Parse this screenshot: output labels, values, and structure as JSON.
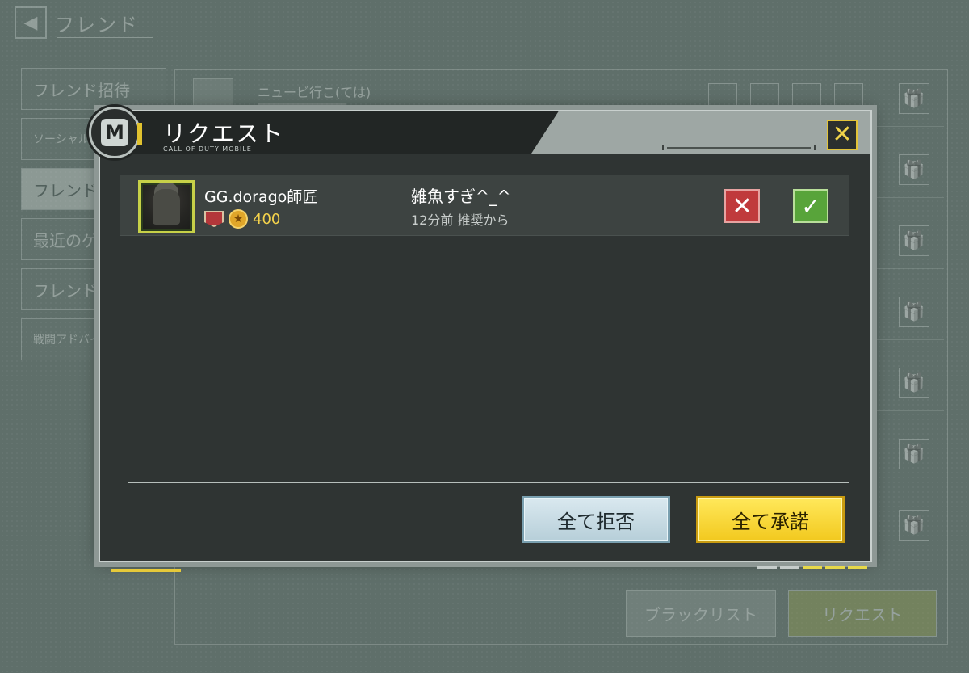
{
  "background": {
    "title": "フレンド",
    "sidebar": [
      {
        "label": "フレンド招待"
      },
      {
        "label": "ソーシャル"
      },
      {
        "label": "フレンド"
      },
      {
        "label": "最近のゲ"
      },
      {
        "label": "フレンド追加"
      },
      {
        "label": "戦闘アドバイ"
      }
    ],
    "list_rows": [
      {
        "name": "ニュービ行こ(ては)"
      },
      {
        "name": ""
      },
      {
        "name": ""
      },
      {
        "name": ""
      },
      {
        "name": ""
      },
      {
        "name": ""
      },
      {
        "name": ""
      },
      {
        "name": ""
      }
    ],
    "blacklist_button": "ブラックリスト",
    "request_button": "リクエスト"
  },
  "dialog": {
    "title": "リクエスト",
    "subtitle": "CALL OF DUTY MOBILE",
    "close_icon": "close-icon",
    "requests": [
      {
        "name": "GG.dorago師匠",
        "level": "400",
        "message": "雑魚すぎ^_^",
        "time": "12分前 推奨から"
      }
    ],
    "reject_all_label": "全て拒否",
    "accept_all_label": "全て承諾",
    "colors": {
      "accent_yellow": "#f2c91f",
      "reject_red": "#c03a3c",
      "accept_green": "#58a43a",
      "dialog_bg": "#2f3433"
    }
  }
}
